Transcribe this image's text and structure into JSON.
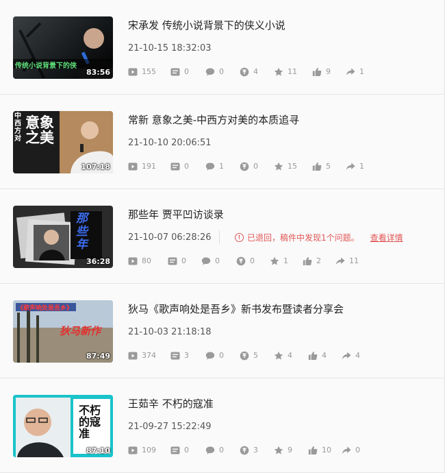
{
  "labels": {
    "reject_message": "已退回，稿件中发现1个问题。",
    "detail_link": "查看详情"
  },
  "colors": {
    "icon": "#9a9a9a",
    "reject": "#e25656",
    "title": "#222222"
  },
  "videos": [
    {
      "title": "宋承发 传统小说背景下的侠义小说",
      "date": "21-10-15 18:32:03",
      "duration": "83:56",
      "thumb_text": "传统小说背景下的侠",
      "stats": {
        "plays": "155",
        "danmaku": "0",
        "comments": "0",
        "coins": "4",
        "favorites": "11",
        "likes": "9",
        "shares": "1"
      }
    },
    {
      "title": "常新 意象之美-中西方对美的本质追寻",
      "date": "21-10-10 20:06:51",
      "duration": "107:18",
      "thumb_text": "意象之美",
      "stats": {
        "plays": "191",
        "danmaku": "0",
        "comments": "1",
        "coins": "0",
        "favorites": "15",
        "likes": "5",
        "shares": "1"
      }
    },
    {
      "title": "那些年 贾平凹访谈录",
      "date": "21-10-07 06:28:26",
      "duration": "36:28",
      "thumb_text": "那些年",
      "stats": {
        "plays": "80",
        "danmaku": "0",
        "comments": "0",
        "coins": "0",
        "favorites": "1",
        "likes": "2",
        "shares": "11"
      }
    },
    {
      "title": "狄马《歌声响处是吾乡》新书发布暨读者分享会",
      "date": "21-10-03 21:18:18",
      "duration": "87:49",
      "thumb_text": "狄马新作",
      "stats": {
        "plays": "374",
        "danmaku": "3",
        "comments": "0",
        "coins": "5",
        "favorites": "4",
        "likes": "4",
        "shares": "4"
      }
    },
    {
      "title": "王茹辛 不朽的寇准",
      "date": "21-09-27 15:22:49",
      "duration": "87:10",
      "thumb_text": "不朽的寇准",
      "stats": {
        "plays": "109",
        "danmaku": "0",
        "comments": "0",
        "coins": "3",
        "favorites": "9",
        "likes": "10",
        "shares": "0"
      }
    }
  ]
}
